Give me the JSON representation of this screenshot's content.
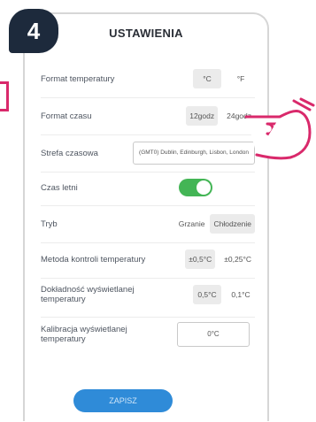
{
  "step": "4",
  "screen": {
    "title": "USTAWIENIA",
    "rows": [
      {
        "label": "Format temperatury",
        "options": [
          "°C",
          "°F"
        ],
        "selected": 0
      },
      {
        "label": "Format czasu",
        "options": [
          "12godz",
          "24godz"
        ],
        "selected": 0
      },
      {
        "label": "Strefa czasowa",
        "value": "(GMT0) Dublin, Edinburgh, Lisbon, London"
      },
      {
        "label": "Czas letni",
        "toggle_on": true
      },
      {
        "label": "Tryb",
        "options": [
          "Grzanie",
          "Chłodzenie"
        ],
        "selected": 1
      },
      {
        "label": "Metoda kontroli temperatury",
        "options": [
          "±0,5°C",
          "±0,25°C"
        ],
        "selected": 0
      },
      {
        "label": "Dokładność wyświetlanej temperatury",
        "options": [
          "0,5°C",
          "0,1°C"
        ],
        "selected": 0
      },
      {
        "label": "Kalibracja wyświetlanej temperatury",
        "value": "0°C"
      }
    ],
    "save_label": "ZAPISZ"
  },
  "colors": {
    "accent_pink": "#d9296b",
    "toggle_green": "#43b555",
    "button_blue": "#2f8bd8",
    "badge_dark": "#1d2a3c"
  },
  "icons": {
    "pointer": "pointing-hand-icon"
  }
}
